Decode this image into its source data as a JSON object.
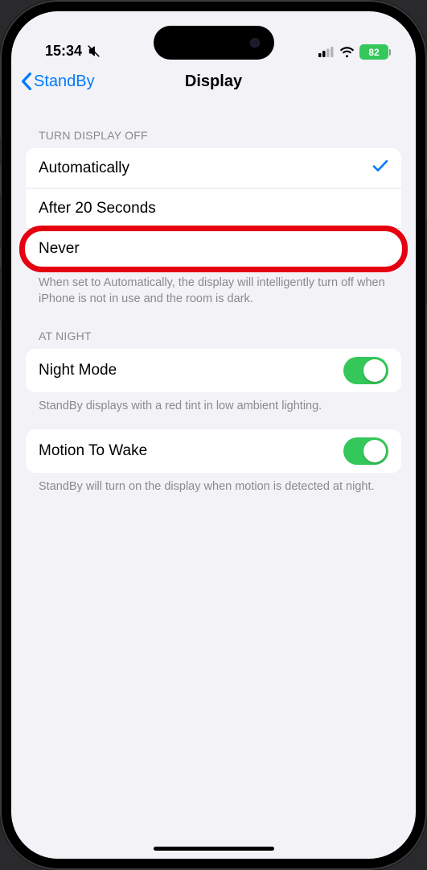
{
  "status": {
    "time": "15:34",
    "battery": "82"
  },
  "nav": {
    "back": "StandBy",
    "title": "Display"
  },
  "sections": {
    "turnOff": {
      "header": "TURN DISPLAY OFF",
      "options": [
        {
          "label": "Automatically",
          "selected": true
        },
        {
          "label": "After 20 Seconds",
          "selected": false
        },
        {
          "label": "Never",
          "selected": false
        }
      ],
      "footer": "When set to Automatically, the display will intelligently turn off when iPhone is not in use and the room is dark."
    },
    "atNight": {
      "header": "AT NIGHT",
      "nightMode": {
        "label": "Night Mode",
        "on": true
      },
      "nightFooter": "StandBy displays with a red tint in low ambient lighting.",
      "motion": {
        "label": "Motion To Wake",
        "on": true
      },
      "motionFooter": "StandBy will turn on the display when motion is detected at night."
    }
  }
}
